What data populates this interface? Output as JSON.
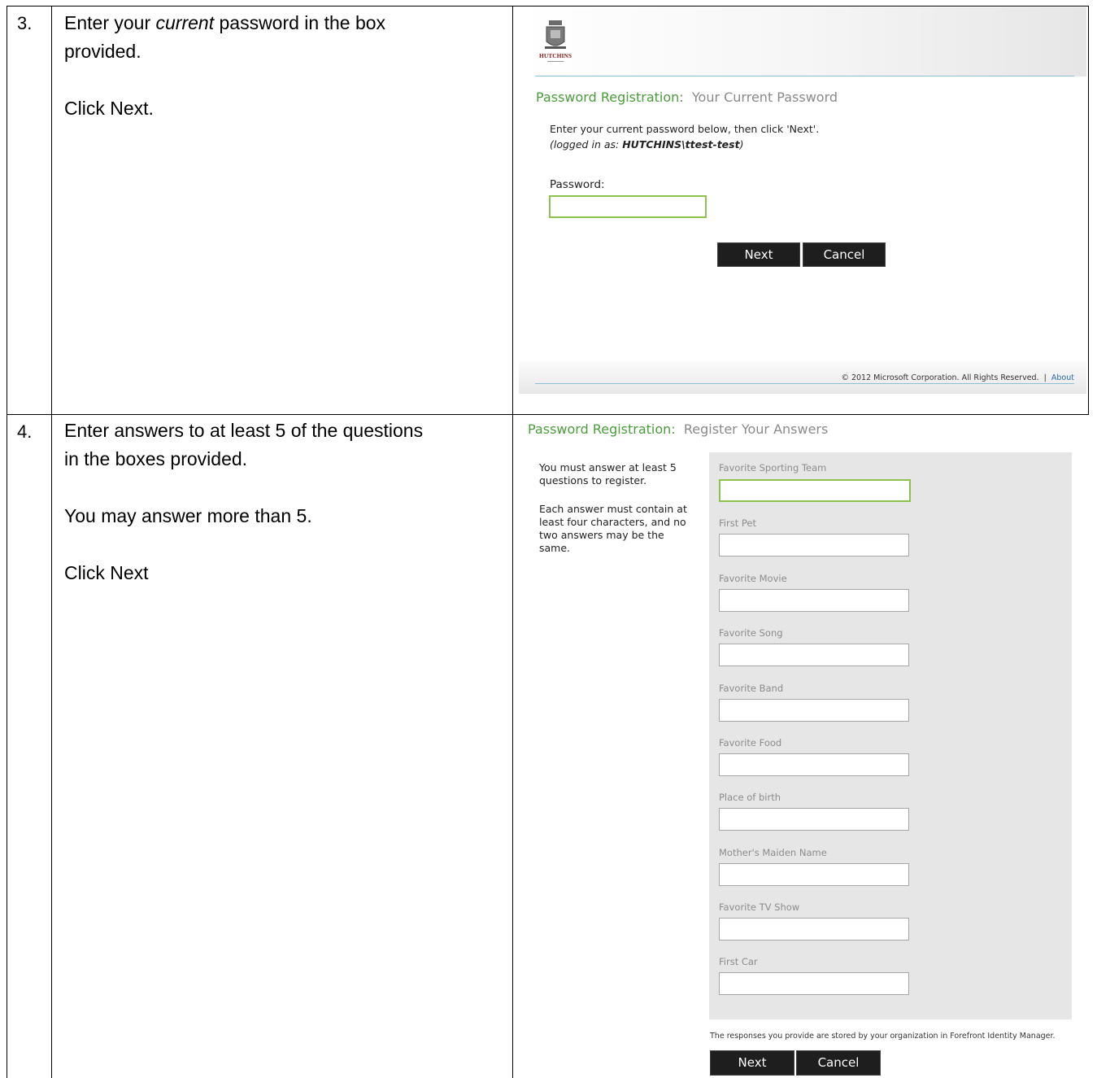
{
  "rows": [
    {
      "number": "3.",
      "instructions": {
        "line1_pre": "Enter your ",
        "line1_em": "current",
        "line1_post": " password in the box",
        "line2": "provided.",
        "line3": "Click Next."
      },
      "screenshot": {
        "logo_text": "HUTCHINS",
        "title_main": "Password Registration:",
        "title_sub": "Your Current Password",
        "prompt": "Enter your current password below, then click 'Next'.",
        "logged_in_prefix": "(logged in as: ",
        "logged_in_user": "HUTCHINS\\ttest-test",
        "logged_in_suffix": ")",
        "password_label": "Password:",
        "password_value": "",
        "next_label": "Next",
        "cancel_label": "Cancel",
        "copyright": "© 2012 Microsoft Corporation. All Rights Reserved.",
        "separator": "|",
        "about_label": "About"
      }
    },
    {
      "number": "4.",
      "instructions": {
        "line1": "Enter answers to at least 5 of the questions",
        "line2": "in the boxes provided.",
        "line3": "You may answer more than 5.",
        "line4": "Click Next"
      },
      "screenshot": {
        "title_main": "Password Registration:",
        "title_sub": "Register Your Answers",
        "help_1": [
          "You must answer at least 5",
          "questions to register."
        ],
        "help_2": [
          "Each answer must contain at",
          "least four characters, and no",
          "two answers may be the",
          "same."
        ],
        "questions": [
          "Favorite Sporting Team",
          "First Pet",
          "Favorite Movie",
          "Favorite Song",
          "Favorite Band",
          "Favorite Food",
          "Place of birth",
          "Mother's Maiden Name",
          "Favorite TV Show",
          "First Car"
        ],
        "storage_note": "The responses you provide are stored by your organization in Forefront Identity Manager.",
        "next_label": "Next",
        "cancel_label": "Cancel"
      }
    }
  ],
  "colors": {
    "accent_green": "#4a9d3a",
    "active_border": "#8cc34c",
    "button_bg": "#1e1e1e",
    "rule_blue": "#8cbfd6",
    "link_blue": "#2a67b0"
  }
}
